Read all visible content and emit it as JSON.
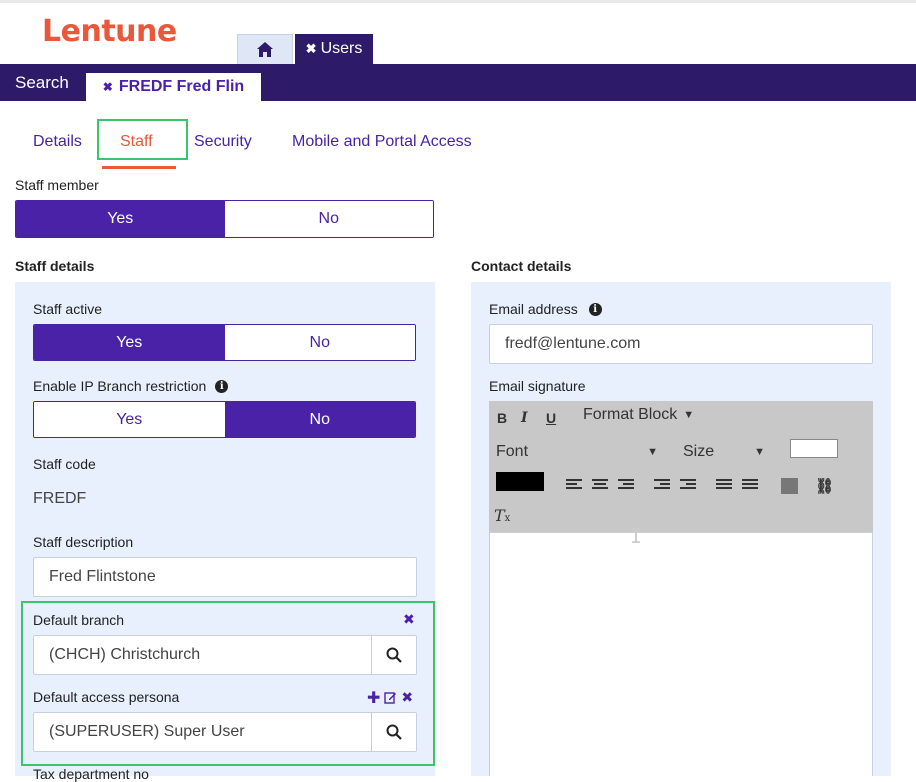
{
  "app": {
    "logo": "Lentune"
  },
  "top_tabs": {
    "users_label": "Users"
  },
  "navbar": {
    "search_label": "Search",
    "record_tab_label": "FREDF Fred Flin"
  },
  "sub_tabs": [
    "Details",
    "Staff",
    "Security",
    "Mobile and Portal Access"
  ],
  "staff_member": {
    "label": "Staff member",
    "yes": "Yes",
    "no": "No",
    "selected": "Yes"
  },
  "staff_details": {
    "title": "Staff details",
    "staff_active": {
      "label": "Staff active",
      "yes": "Yes",
      "no": "No",
      "selected": "Yes"
    },
    "ip_restriction": {
      "label": "Enable IP Branch restriction",
      "yes": "Yes",
      "no": "No",
      "selected": "No"
    },
    "staff_code": {
      "label": "Staff code",
      "value": "FREDF"
    },
    "staff_description": {
      "label": "Staff description",
      "value": "Fred Flintstone"
    },
    "default_branch": {
      "label": "Default branch",
      "value": "(CHCH) Christchurch"
    },
    "default_persona": {
      "label": "Default access persona",
      "value": "(SUPERUSER) Super User"
    },
    "tax_department": {
      "label": "Tax department no"
    }
  },
  "contact_details": {
    "title": "Contact details",
    "email": {
      "label": "Email address",
      "value": "fredf@lentune.com"
    },
    "signature": {
      "label": "Email signature",
      "toolbar": {
        "format_block": "Format Block",
        "font": "Font",
        "size": "Size"
      }
    }
  },
  "colors": {
    "brand": "#e8583b",
    "primary": "#4a22a8",
    "nav": "#2d1b69",
    "panel": "#e7f0fc",
    "highlight": "#3cc46a"
  }
}
